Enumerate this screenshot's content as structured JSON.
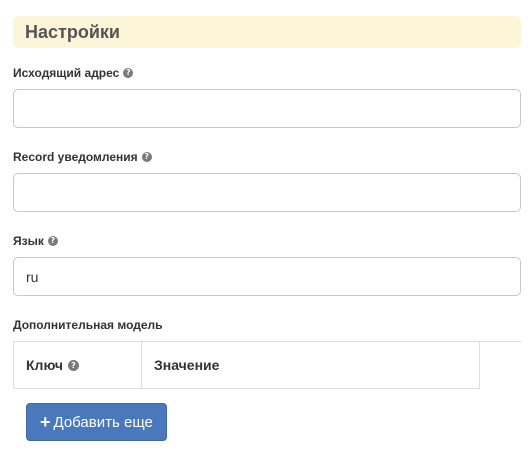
{
  "section": {
    "title": "Настройки"
  },
  "fields": {
    "source_address": {
      "label": "Исходящий адрес",
      "value": ""
    },
    "record_notification": {
      "label": "Record уведомления",
      "value": ""
    },
    "language": {
      "label": "Язык",
      "value": "ru"
    },
    "extra_model": {
      "label": "Дополнительная модель"
    }
  },
  "table": {
    "key_header": "Ключ",
    "value_header": "Значение"
  },
  "buttons": {
    "add_more": "Добавить еще"
  },
  "icons": {
    "help": "question-circle-icon",
    "plus": "plus-icon"
  },
  "colors": {
    "header_bg": "#fcf5d8",
    "button_bg": "#4a78bd"
  }
}
